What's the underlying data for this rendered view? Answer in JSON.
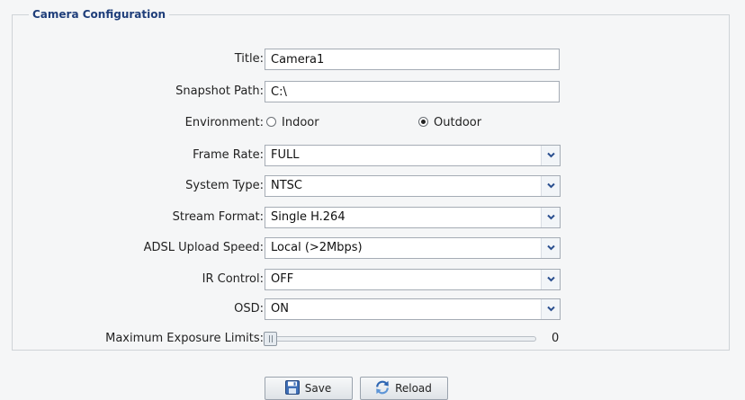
{
  "section": {
    "legend": "Camera Configuration"
  },
  "fields": {
    "title": {
      "label": "Title:",
      "value": "Camera1"
    },
    "snapshot_path": {
      "label": "Snapshot Path:",
      "value": "C:\\"
    },
    "environment": {
      "label": "Environment:",
      "options": [
        "Indoor",
        "Outdoor"
      ],
      "selected": "Outdoor"
    },
    "frame_rate": {
      "label": "Frame Rate:",
      "value": "FULL"
    },
    "system_type": {
      "label": "System Type:",
      "value": "NTSC"
    },
    "stream_format": {
      "label": "Stream Format:",
      "value": "Single H.264"
    },
    "adsl_upload_speed": {
      "label": "ADSL Upload Speed:",
      "value": "Local (>2Mbps)"
    },
    "ir_control": {
      "label": "IR Control:",
      "value": "OFF"
    },
    "osd": {
      "label": "OSD:",
      "value": "ON"
    },
    "max_exposure": {
      "label": "Maximum Exposure Limits:",
      "value": "0",
      "fraction": 0.0
    }
  },
  "buttons": {
    "save": "Save",
    "reload": "Reload"
  },
  "icons": {
    "dropdown": "chevron-down-icon",
    "save": "floppy-disk-icon",
    "reload": "refresh-icon"
  },
  "colors": {
    "panel_bg": "#f5f6f7",
    "legend_text": "#1f3e7a",
    "input_border": "#a5acb5",
    "dropdown_arrow": "#2a4f8f"
  }
}
